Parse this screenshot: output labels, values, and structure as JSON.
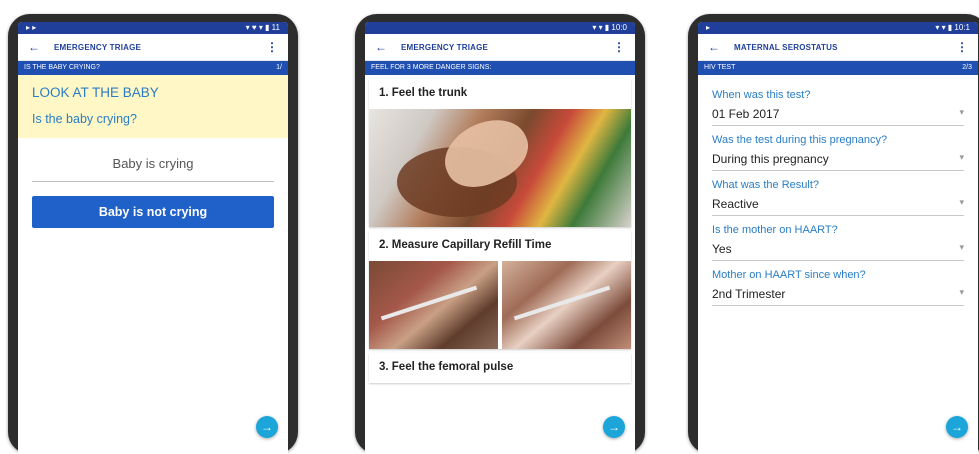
{
  "screen1": {
    "status_left": "▸ ▸",
    "status_right": "▾ ♥ ▾ ▮ 11",
    "app_title": "EMERGENCY TRIAGE",
    "section_label": "IS THE BABY CRYING?",
    "section_progress": "1/",
    "look_heading": "LOOK AT THE BABY",
    "question": "Is the baby crying?",
    "option_1": "Baby is crying",
    "option_2": "Baby is not crying"
  },
  "screen2": {
    "status_right": "▾ ▾ ▮ 10:0",
    "app_title": "EMERGENCY TRIAGE",
    "section_label": "FEEL FOR 3 MORE DANGER SIGNS:",
    "cards": [
      {
        "title": "1. Feel the trunk"
      },
      {
        "title": "2. Measure Capillary Refill Time"
      },
      {
        "title": "3. Feel the femoral pulse"
      }
    ]
  },
  "screen3": {
    "status_left": "▸",
    "status_right": "▾ ▾ ▮ 10:1",
    "app_title": "MATERNAL SEROSTATUS",
    "section_label": "HIV TEST",
    "section_progress": "2/3",
    "fields": [
      {
        "label": "When was this test?",
        "value": "01 Feb 2017"
      },
      {
        "label": "Was the test during this pregnancy?",
        "value": "During this pregnancy"
      },
      {
        "label": "What was the Result?",
        "value": "Reactive"
      },
      {
        "label": "Is the mother on HAART?",
        "value": "Yes"
      },
      {
        "label": "Mother on HAART since when?",
        "value": "2nd Trimester"
      }
    ]
  },
  "icons": {
    "back": "←",
    "menu": "⋮",
    "next": "→",
    "dropdown": "▾"
  },
  "colors": {
    "primary": "#1f3f9a",
    "section": "#1f4fb0",
    "accent": "#2a7dc4",
    "button": "#1f61c8",
    "fab": "#1ba5d9",
    "highlight": "#fff7c6"
  }
}
